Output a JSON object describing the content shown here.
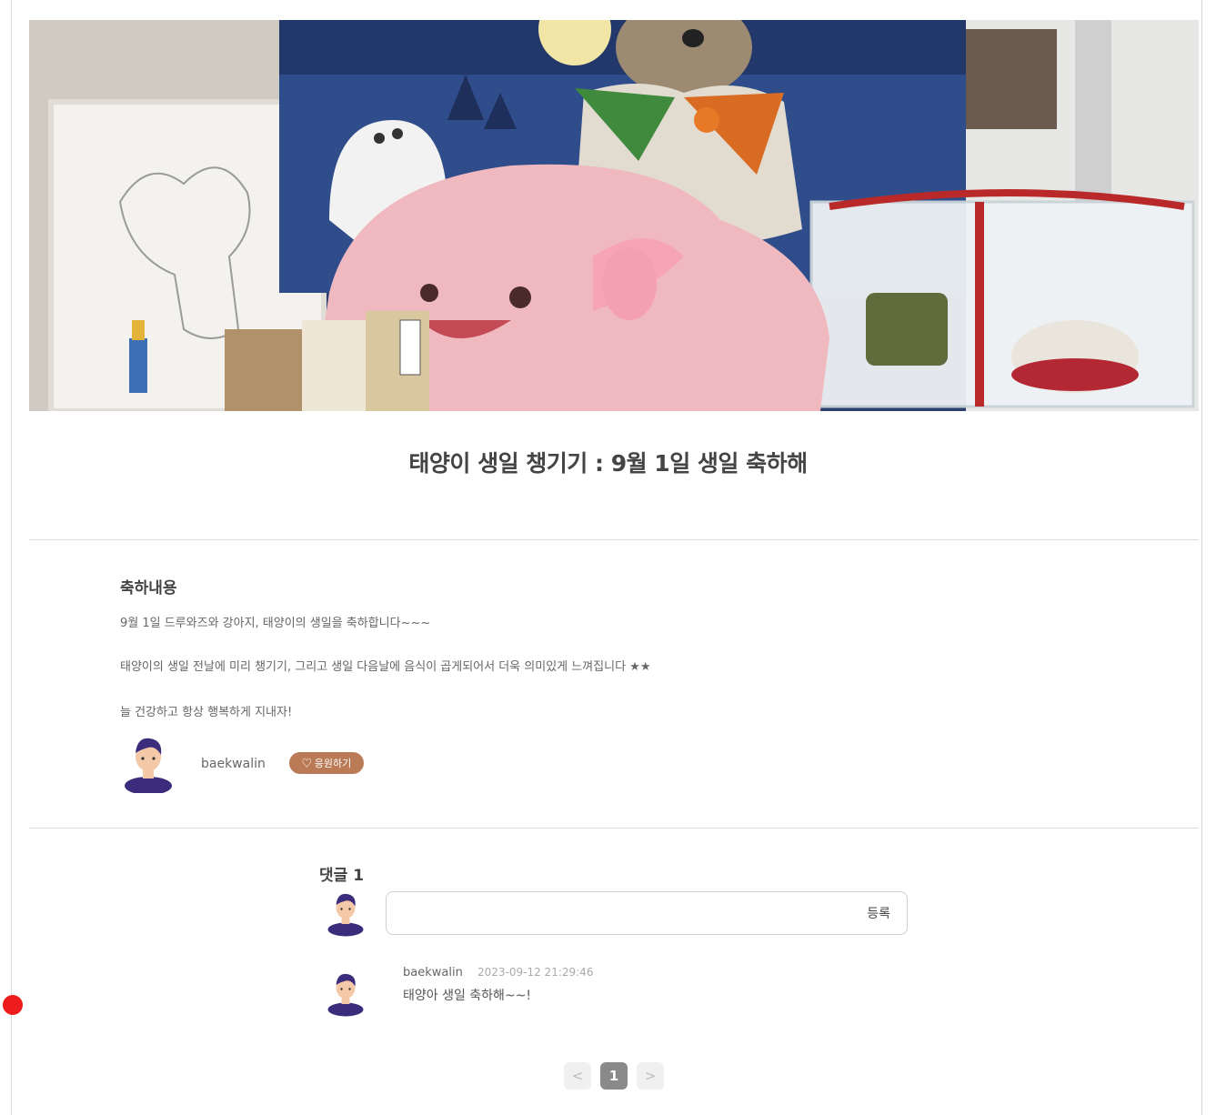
{
  "post": {
    "title": "태양이 생일 챙기기 : 9월 1일 생일 축하해",
    "image_alt": "태양이 생일 사진"
  },
  "content": {
    "heading": "축하내용",
    "lines": [
      "9월 1일 드루와즈와 강아지, 태양이의 생일을 축하합니다~~~",
      "태양이의 생일 전날에 미리 챙기기, 그리고 생일 다음날에 음식이 곱게되어서 더욱 의미있게 느껴집니다 ★★",
      "늘 건강하고 항상 행복하게 지내자!"
    ]
  },
  "author": {
    "name": "baekwalin",
    "cheer_label": "♡ 응원하기"
  },
  "comments": {
    "count_label": "댓글 1",
    "input_placeholder": "",
    "submit_label": "등록",
    "items": [
      {
        "author": "baekwalin",
        "date": "2023-09-12 21:29:46",
        "text": "태양아 생일 축하해~~!"
      }
    ]
  },
  "pagination": {
    "prev": "<",
    "current": "1",
    "next": ">"
  },
  "colors": {
    "accent": "#b97a55",
    "page_active": "#8a8a8a",
    "marker": "#ee1c1c"
  },
  "icons": {
    "avatar": "avatar-icon",
    "prev": "chevron-left-icon",
    "next": "chevron-right-icon"
  }
}
